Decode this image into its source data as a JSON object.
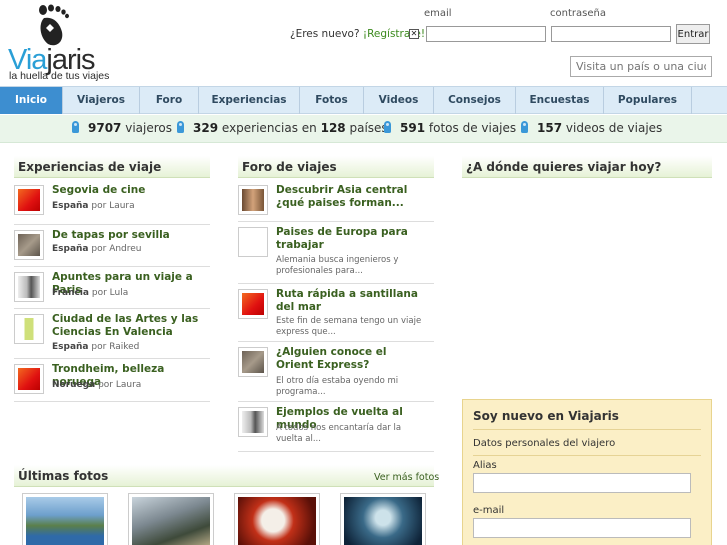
{
  "brand": {
    "name_part1": "Via",
    "name_part2": "jaris",
    "tagline": "la huella de tus viajes"
  },
  "login": {
    "email_label": "email",
    "password_label": "contraseña",
    "nuevo_text": "¿Eres nuevo?",
    "register_link": "¡Regístrate!",
    "submit_label": "Entrar"
  },
  "search": {
    "placeholder": "Visita un país o una ciudad."
  },
  "nav": [
    {
      "label": "Inicio",
      "active": true
    },
    {
      "label": "Viajeros"
    },
    {
      "label": "Foro"
    },
    {
      "label": "Experiencias"
    },
    {
      "label": "Fotos"
    },
    {
      "label": "Videos"
    },
    {
      "label": "Consejos"
    },
    {
      "label": "Encuestas"
    },
    {
      "label": "Populares"
    }
  ],
  "stats": {
    "viajeros_num": "9707",
    "viajeros_label": "viajeros",
    "experiencias_num": "329",
    "experiencias_label": "experiencias en",
    "paises_num": "128",
    "paises_label": "países",
    "fotos_num": "591",
    "fotos_label": "fotos de viajes",
    "videos_num": "157",
    "videos_label": "videos de viajes"
  },
  "experiencias": {
    "title": "Experiencias de viaje",
    "por": "por",
    "items": [
      {
        "title": "Segovia de cine",
        "country": "España",
        "author": "Laura"
      },
      {
        "title": "De tapas por sevilla",
        "country": "España",
        "author": "Andreu"
      },
      {
        "title": "Apuntes para un viaje a Paris",
        "country": "Francia",
        "author": "Lula"
      },
      {
        "title": "Ciudad de las Artes y las Ciencias En Valencia",
        "country": "España",
        "author": "Raiked"
      },
      {
        "title": "Trondheim, belleza noruega",
        "country": "Noruega",
        "author": "Laura"
      }
    ]
  },
  "foro": {
    "title": "Foro de viajes",
    "items": [
      {
        "title": "Descubrir Asia central ¿qué paises forman...",
        "excerpt": ""
      },
      {
        "title": "Paises de Europa para trabajar",
        "excerpt": "Alemania busca ingenieros y profesionales para..."
      },
      {
        "title": "Ruta rápida a santillana del mar",
        "excerpt": "Este fin de semana tengo un viaje express que..."
      },
      {
        "title": "¿Alguien conoce el Orient Express?",
        "excerpt": "El otro día estaba oyendo mi programa..."
      },
      {
        "title": "Ejemplos de vuelta al mundo",
        "excerpt": "A todos nos encantaría dar la vuelta al..."
      }
    ]
  },
  "destino": {
    "title": "¿A dónde quieres viajar hoy?"
  },
  "ultimas_fotos": {
    "title": "Últimas fotos",
    "more": "Ver más fotos"
  },
  "register": {
    "title": "Soy nuevo en Viajaris",
    "subtitle": "Datos personales del viajero",
    "alias_label": "Alias",
    "email_label": "e-mail"
  },
  "colors": {
    "brand_blue": "#2a9fd6",
    "nav_active": "#3d8ed0",
    "link_green": "#3a6020"
  }
}
